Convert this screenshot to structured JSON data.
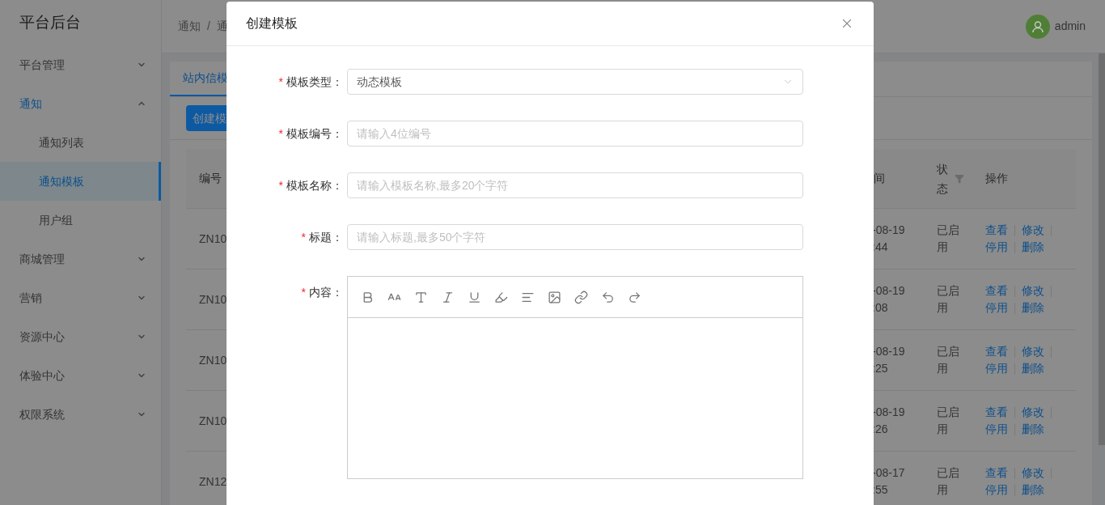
{
  "sidebar": {
    "title": "平台后台",
    "items": [
      {
        "label": "平台管理",
        "expanded": false
      },
      {
        "label": "通知",
        "expanded": true,
        "children": [
          {
            "label": "通知列表",
            "selected": false
          },
          {
            "label": "通知模板",
            "selected": true
          },
          {
            "label": "用户组",
            "selected": false
          }
        ]
      },
      {
        "label": "商城管理",
        "expanded": false
      },
      {
        "label": "营销",
        "expanded": false
      },
      {
        "label": "资源中心",
        "expanded": false
      },
      {
        "label": "体验中心",
        "expanded": false
      },
      {
        "label": "权限系统",
        "expanded": false
      }
    ]
  },
  "header": {
    "breadcrumb": [
      "通知",
      "通"
    ],
    "separator": "/",
    "user": "admin"
  },
  "tabs": [
    {
      "label": "站内信模",
      "selected": true
    }
  ],
  "create_button": "创建模",
  "table": {
    "columns": [
      {
        "label": "编号",
        "filter": false
      },
      {
        "label": "间",
        "filter": false
      },
      {
        "label": "状态",
        "filter": true
      },
      {
        "label": "操作",
        "filter": false
      }
    ],
    "rows": [
      {
        "id": "ZN10",
        "date": "-08-19",
        "time": ":44",
        "status": "已启用",
        "actions": [
          "查看",
          "修改",
          "停用",
          "删除"
        ]
      },
      {
        "id": "ZN10",
        "date": "-08-19",
        "time": ":08",
        "status": "已启用",
        "actions": [
          "查看",
          "修改",
          "停用",
          "删除"
        ]
      },
      {
        "id": "ZN10",
        "date": "-08-19",
        "time": ":25",
        "status": "已启用",
        "actions": [
          "查看",
          "修改",
          "停用",
          "删除"
        ]
      },
      {
        "id": "ZN10",
        "date": "-08-19",
        "time": ":26",
        "status": "已启用",
        "actions": [
          "查看",
          "修改",
          "停用",
          "删除"
        ]
      },
      {
        "id": "ZN12",
        "date": "-08-17",
        "time": ":55",
        "status": "已启用",
        "actions": [
          "查看",
          "修改",
          "停用",
          "删除"
        ]
      }
    ]
  },
  "modal": {
    "title": "创建模板",
    "required_mark": "*",
    "fields": [
      {
        "kind": "select",
        "label": "模板类型：",
        "required": true,
        "value": "动态模板"
      },
      {
        "kind": "input",
        "label": "模板编号：",
        "required": true,
        "placeholder": "请输入4位编号"
      },
      {
        "kind": "input",
        "label": "模板名称：",
        "required": true,
        "placeholder": "请输入模板名称,最多20个字符"
      },
      {
        "kind": "input",
        "label": "标题：",
        "required": true,
        "placeholder": "请输入标题,最多50个字符"
      },
      {
        "kind": "editor",
        "label": "内容：",
        "required": true
      }
    ]
  }
}
